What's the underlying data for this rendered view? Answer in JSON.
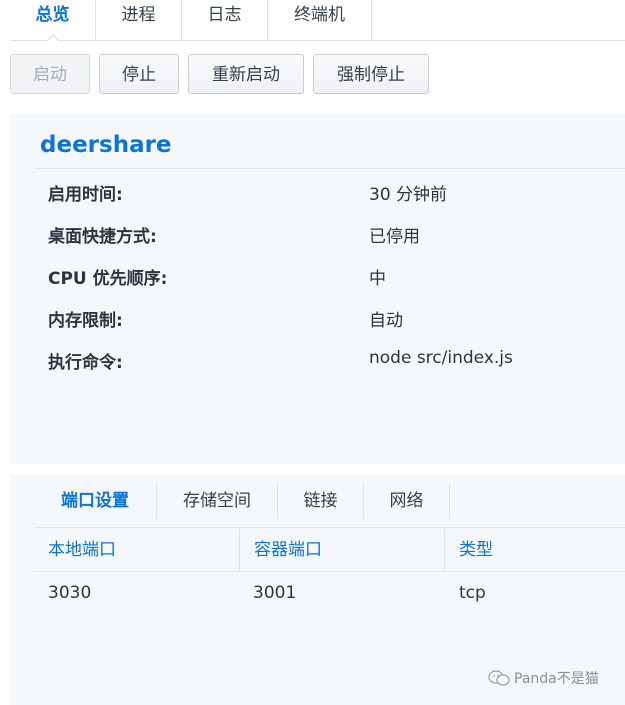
{
  "top_tabs": [
    "总览",
    "进程",
    "日志",
    "终端机"
  ],
  "actions": {
    "start": "启动",
    "stop": "停止",
    "restart": "重新启动",
    "force_stop": "强制停止"
  },
  "app": {
    "name": "deershare",
    "rows": [
      {
        "label": "启用时间:",
        "value": "30 分钟前"
      },
      {
        "label": "桌面快捷方式:",
        "value": "已停用"
      },
      {
        "label": "CPU 优先顺序:",
        "value": "中"
      },
      {
        "label": "内存限制:",
        "value": "自动"
      },
      {
        "label": "执行命令:",
        "value": "node src/index.js"
      }
    ]
  },
  "port_panel": {
    "tabs": [
      "端口设置",
      "存储空间",
      "链接",
      "网络"
    ],
    "columns": [
      "本地端口",
      "容器端口",
      "类型"
    ],
    "rows": [
      [
        "3030",
        "3001",
        "tcp"
      ]
    ]
  },
  "watermark": "Panda不是猫",
  "colors": {
    "accent": "#0b74d6",
    "panel_bg": "#f5f8fa"
  }
}
